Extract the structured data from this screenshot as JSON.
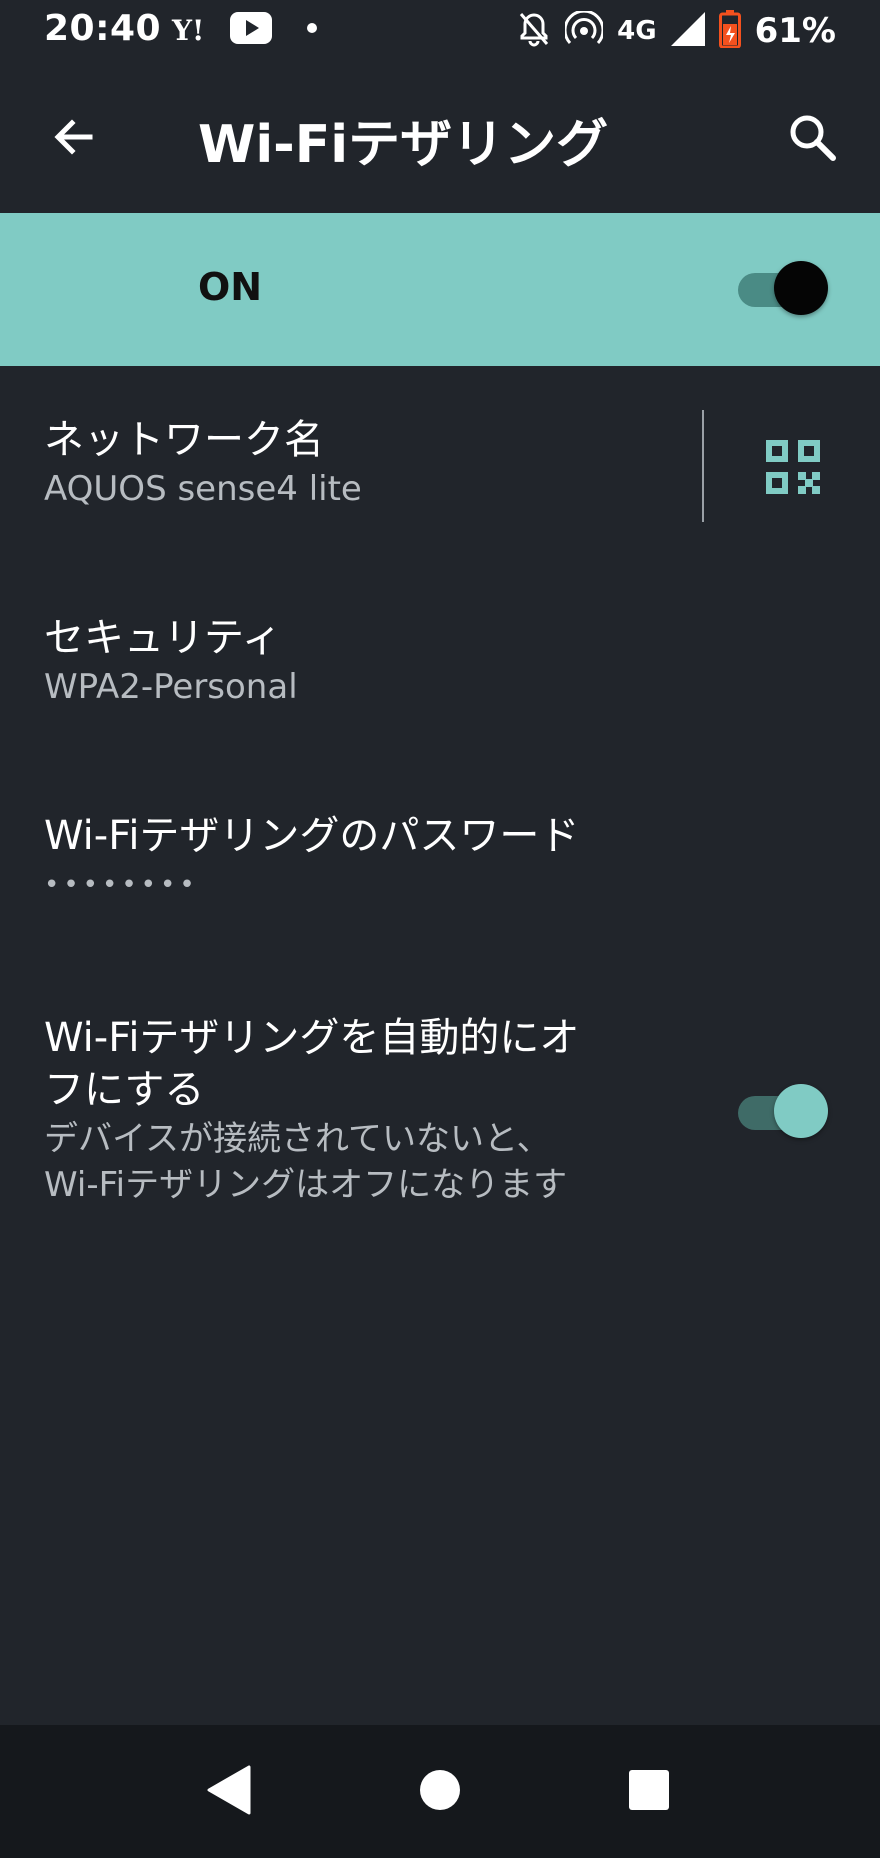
{
  "status_bar": {
    "time": "20:40",
    "network": "4G",
    "battery": "61%",
    "icons": [
      "yahoo-icon",
      "youtube-icon",
      "dot-icon",
      "notifications-off-icon",
      "hotspot-icon",
      "signal-icon",
      "battery-icon"
    ]
  },
  "app_bar": {
    "title": "Wi-Fiテザリング"
  },
  "master_switch": {
    "label": "ON",
    "checked": true
  },
  "preferences": {
    "network_name": {
      "title": "ネットワーク名",
      "summary": "AQUOS sense4 lite"
    },
    "security": {
      "title": "セキュリティ",
      "summary": "WPA2-Personal"
    },
    "password": {
      "title": "Wi-Fiテザリングのパスワード",
      "summary": "••••••••"
    },
    "auto_off": {
      "title_line1": "Wi-Fiテザリングを自動的にオ",
      "title_line2": "フにする",
      "summary_line1": "デバイスが接続されていないと、",
      "summary_line2": "Wi-Fiテザリングはオフになります",
      "checked": true
    }
  },
  "colors": {
    "background": "#21252b",
    "accent": "#80cbc4",
    "nav_bar": "#15181c"
  }
}
